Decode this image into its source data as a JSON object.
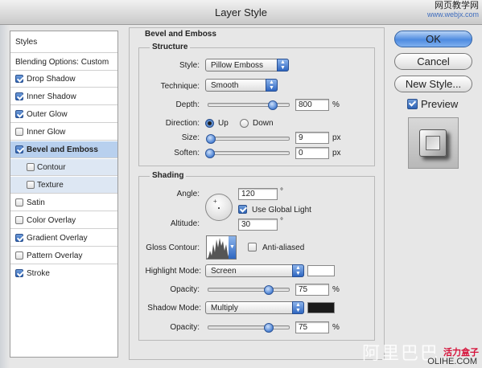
{
  "window": {
    "title": "Layer Style"
  },
  "watermark_top": {
    "line1": "网页教学网",
    "line2": "www.webjx.com"
  },
  "watermark_bottom": {
    "text": "阿里巴巴",
    "brand": "活力盒子",
    "domain": "OLIHE.COM"
  },
  "left_list": {
    "styles_label": "Styles",
    "blending_label": "Blending Options: Custom",
    "items": [
      {
        "label": "Drop Shadow",
        "checked": true
      },
      {
        "label": "Inner Shadow",
        "checked": true
      },
      {
        "label": "Outer Glow",
        "checked": true
      },
      {
        "label": "Inner Glow",
        "checked": false
      },
      {
        "label": "Bevel and Emboss",
        "checked": true,
        "selected": true
      },
      {
        "label": "Contour",
        "checked": false,
        "sub": true
      },
      {
        "label": "Texture",
        "checked": false,
        "sub": true
      },
      {
        "label": "Satin",
        "checked": false
      },
      {
        "label": "Color Overlay",
        "checked": false
      },
      {
        "label": "Gradient Overlay",
        "checked": true
      },
      {
        "label": "Pattern Overlay",
        "checked": false
      },
      {
        "label": "Stroke",
        "checked": true
      }
    ]
  },
  "bevel": {
    "section_title": "Bevel and Emboss",
    "structure_title": "Structure",
    "style_label": "Style:",
    "style_value": "Pillow Emboss",
    "technique_label": "Technique:",
    "technique_value": "Smooth",
    "depth_label": "Depth:",
    "depth_value": "800",
    "depth_unit": "%",
    "direction_label": "Direction:",
    "direction_up": "Up",
    "direction_down": "Down",
    "size_label": "Size:",
    "size_value": "9",
    "size_unit": "px",
    "soften_label": "Soften:",
    "soften_value": "0",
    "soften_unit": "px"
  },
  "shading": {
    "title": "Shading",
    "angle_label": "Angle:",
    "angle_value": "120",
    "angle_unit": "°",
    "global_light_label": "Use Global Light",
    "altitude_label": "Altitude:",
    "altitude_value": "30",
    "altitude_unit": "°",
    "gloss_label": "Gloss Contour:",
    "anti_aliased_label": "Anti-aliased",
    "highlight_mode_label": "Highlight Mode:",
    "highlight_mode_value": "Screen",
    "highlight_color": "#ffffff",
    "opacity_label": "Opacity:",
    "highlight_opacity_value": "75",
    "shadow_mode_label": "Shadow Mode:",
    "shadow_mode_value": "Multiply",
    "shadow_color": "#1a1a1a",
    "shadow_opacity_value": "75",
    "percent": "%"
  },
  "buttons": {
    "ok": "OK",
    "cancel": "Cancel",
    "new_style": "New Style...",
    "preview": "Preview"
  }
}
